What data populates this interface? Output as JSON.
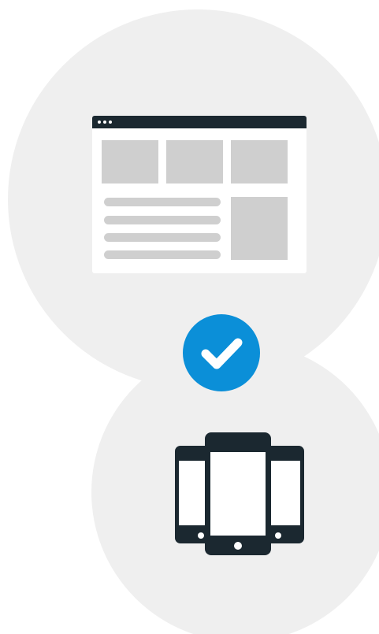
{
  "colors": {
    "background": "#ffffff",
    "circle": "#efefef",
    "dark": "#1b2830",
    "placeholder": "#cfcfcf",
    "accent": "#0b8fd8",
    "white": "#ffffff"
  },
  "icons": {
    "browser": "browser-window-icon",
    "check": "check-badge-icon",
    "devices": "mobile-devices-icon"
  }
}
